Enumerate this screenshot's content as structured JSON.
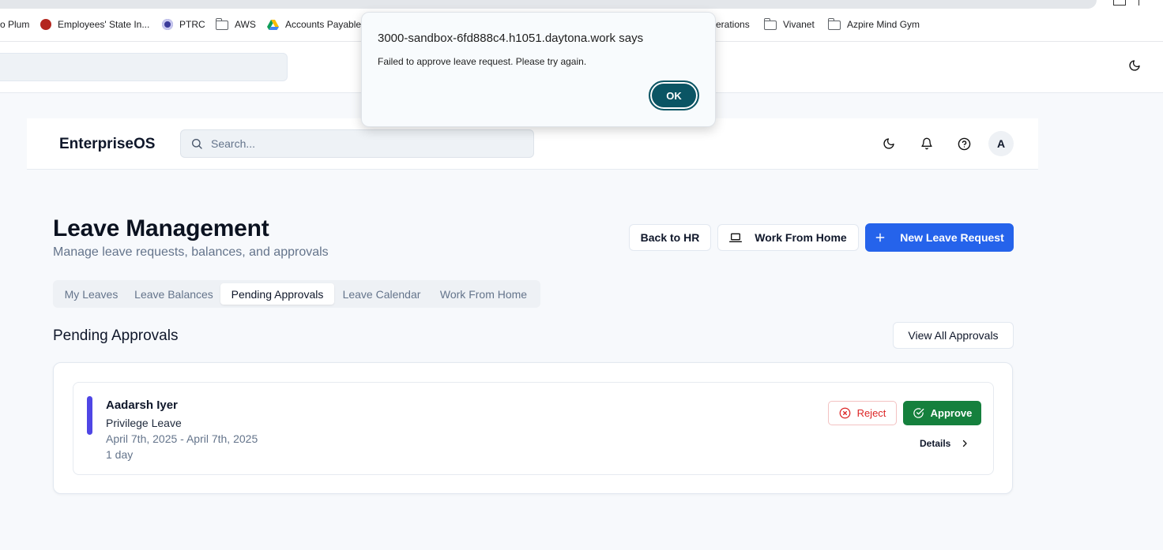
{
  "browser": {
    "bookmarks": [
      {
        "label": "o Plum",
        "icon": "none",
        "x": 0
      },
      {
        "label": "Employees' State In...",
        "icon": "esi-logo-icon",
        "color": "#b3261e"
      },
      {
        "label": "PTRC",
        "icon": "ptrc-logo-icon",
        "color": "#3b3b9a"
      },
      {
        "label": "AWS",
        "icon": "folder-icon"
      },
      {
        "label": "Accounts Payable",
        "icon": "google-drive-icon"
      },
      {
        "label": "erations",
        "icon": "none"
      },
      {
        "label": "Vivanet",
        "icon": "folder-icon"
      },
      {
        "label": "Azpire Mind Gym",
        "icon": "folder-icon"
      }
    ]
  },
  "dialog": {
    "title": "3000-sandbox-6fd888c4.h1051.daytona.work says",
    "message": "Failed to approve leave request. Please try again.",
    "ok_label": "OK",
    "ok_color": "#0b5564"
  },
  "header": {
    "brand": "EnterpriseOS",
    "search_placeholder": "Search...",
    "avatar_initial": "A"
  },
  "page": {
    "title": "Leave Management",
    "subtitle": "Manage leave requests, balances, and approvals",
    "actions": {
      "back": "Back to HR",
      "wfh": "Work From Home",
      "new": "New Leave Request"
    },
    "accent_color": "#2563eb"
  },
  "tabs": [
    {
      "label": "My Leaves",
      "active": false
    },
    {
      "label": "Leave Balances",
      "active": false
    },
    {
      "label": "Pending Approvals",
      "active": true
    },
    {
      "label": "Leave Calendar",
      "active": false
    },
    {
      "label": "Work From Home",
      "active": false
    }
  ],
  "section": {
    "title": "Pending Approvals",
    "view_all": "View All Approvals"
  },
  "requests": [
    {
      "name": "Aadarsh Iyer",
      "type": "Privilege Leave",
      "dates": "April 7th, 2025 - April 7th, 2025",
      "duration": "1 day",
      "reject_label": "Reject",
      "approve_label": "Approve",
      "details_label": "Details",
      "approve_color": "#15803d",
      "reject_color": "#dc2626"
    }
  ]
}
